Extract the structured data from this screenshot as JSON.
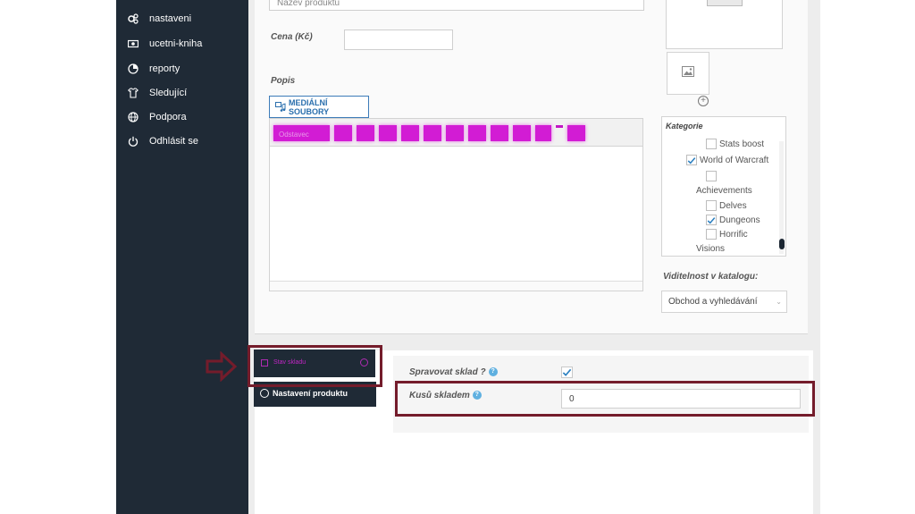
{
  "sidebar": {
    "items": [
      {
        "label": "nastaveni",
        "icon": "cogs-icon"
      },
      {
        "label": "ucetni-kniha",
        "icon": "money-icon"
      },
      {
        "label": "reporty",
        "icon": "pie-chart-icon"
      },
      {
        "label": "Sledující",
        "icon": "shirt-icon"
      },
      {
        "label": "Podpora",
        "icon": "globe-icon"
      },
      {
        "label": "Odhlásit se",
        "icon": "power-icon"
      }
    ]
  },
  "product": {
    "name_placeholder": "Název produktu",
    "price_label": "Cena (Kč)",
    "price_value": "",
    "description_label": "Popis",
    "media_button": "MEDIÁLNÍ SOUBORY",
    "toolbar_first": "Odstavec"
  },
  "category": {
    "title": "Kategorie",
    "items": [
      {
        "label": "Stats boost",
        "checked": false
      },
      {
        "label": "World of Warcraft",
        "checked": true
      },
      {
        "label": "",
        "checked": false
      },
      {
        "label": "Achievements",
        "checked": false
      },
      {
        "label": "Delves",
        "checked": false
      },
      {
        "label": "Dungeons",
        "checked": true
      },
      {
        "label": "Horrific",
        "checked": false
      },
      {
        "label": "Visions",
        "checked": false
      }
    ]
  },
  "visibility": {
    "label": "Viditelnost v katalogu:",
    "value": "Obchod a vyhledávání"
  },
  "tabs": {
    "stock": "Stav skladu",
    "settings": "Nastavení produktu"
  },
  "stock": {
    "manage_label": "Spravovat sklad ?",
    "manage_checked": true,
    "qty_label": "Kusů skladem",
    "qty_value": "0",
    "help": "?"
  },
  "colors": {
    "sidebar": "#1f2a36",
    "highlight": "#741c2b",
    "toolbar_glow": "#d21cd4",
    "link_blue": "#2a6fad"
  }
}
